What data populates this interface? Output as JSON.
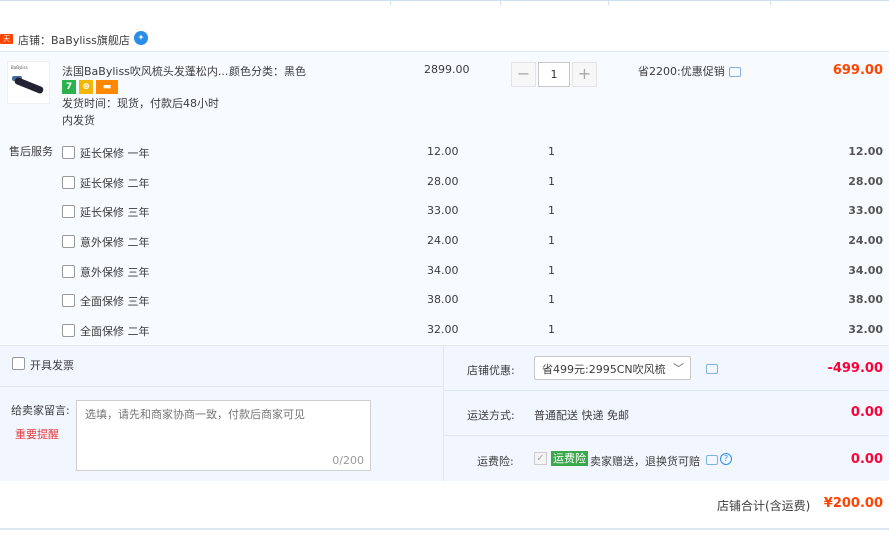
{
  "shop": {
    "tag": "天猫",
    "name": "店铺：BaByliss旗舰店"
  },
  "product": {
    "thumb_brand": "BaByliss",
    "title": "法国BaByliss吹风梳头发蓬松内...",
    "spec": "颜色分类：黑色",
    "badges": [
      "7",
      "⊕",
      "▬"
    ],
    "shipping_line1": "发货时间：现货，付款后48小时",
    "shipping_line2": "内发货",
    "price": "2899.00",
    "quantity": "1",
    "minus": "−",
    "plus": "+",
    "promo": "省2200:优惠促销",
    "subtotal": "699.00"
  },
  "service": {
    "label": "售后服务",
    "items": [
      {
        "name": "延长保修  一年",
        "price": "12.00",
        "qty": "1",
        "total": "12.00"
      },
      {
        "name": "延长保修  二年",
        "price": "28.00",
        "qty": "1",
        "total": "28.00"
      },
      {
        "name": "延长保修  三年",
        "price": "33.00",
        "qty": "1",
        "total": "33.00"
      },
      {
        "name": "意外保修  二年",
        "price": "24.00",
        "qty": "1",
        "total": "24.00"
      },
      {
        "name": "意外保修  三年",
        "price": "34.00",
        "qty": "1",
        "total": "34.00"
      },
      {
        "name": "全面保修  三年",
        "price": "38.00",
        "qty": "1",
        "total": "38.00"
      },
      {
        "name": "全面保修  二年",
        "price": "32.00",
        "qty": "1",
        "total": "32.00"
      }
    ]
  },
  "invoice": {
    "label": "开具发票"
  },
  "message": {
    "label": "给卖家留言:",
    "warning": "重要提醒",
    "placeholder": "选填，请先和商家协商一致，付款后商家可见",
    "count": "0/200"
  },
  "coupon": {
    "label": "店铺优惠:",
    "selected": "省499元:2995CN吹风梳",
    "value": "-499.00"
  },
  "delivery": {
    "label": "运送方式:",
    "text": "普通配送 快递 免邮",
    "value": "0.00"
  },
  "insurance": {
    "label": "运费险:",
    "tag": "运费险",
    "text": "卖家赠送，退换货可赔",
    "value": "0.00"
  },
  "total": {
    "label": "店铺合计(含运费)",
    "value": "¥200.00"
  }
}
